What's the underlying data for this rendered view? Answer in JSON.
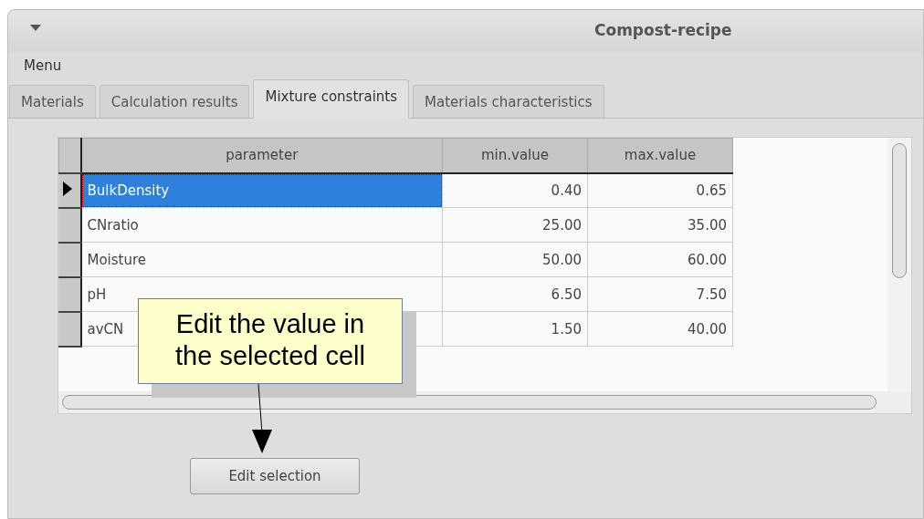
{
  "window": {
    "title": "Compost-recipe"
  },
  "menu": [
    "Menu"
  ],
  "tabs": [
    {
      "label": "Materials",
      "selected": false
    },
    {
      "label": "Calculation results",
      "selected": false
    },
    {
      "label": "Mixture constraints",
      "selected": true
    },
    {
      "label": "Materials characteristics",
      "selected": false
    }
  ],
  "table": {
    "columns": [
      "parameter",
      "min.value",
      "max.value"
    ],
    "rows": [
      {
        "cells": [
          "BulkDensity",
          "0.40",
          "0.65"
        ],
        "selected": true
      },
      {
        "cells": [
          "CNratio",
          "25.00",
          "35.00"
        ],
        "selected": false
      },
      {
        "cells": [
          "Moisture",
          "50.00",
          "60.00"
        ],
        "selected": false
      },
      {
        "cells": [
          "pH",
          "6.50",
          "7.50"
        ],
        "selected": false
      },
      {
        "cells": [
          "avCN",
          "1.50",
          "40.00"
        ],
        "selected": false
      }
    ]
  },
  "callout": {
    "text": "Edit the value in the selected cell"
  },
  "buttons": [
    "Edit selection"
  ]
}
